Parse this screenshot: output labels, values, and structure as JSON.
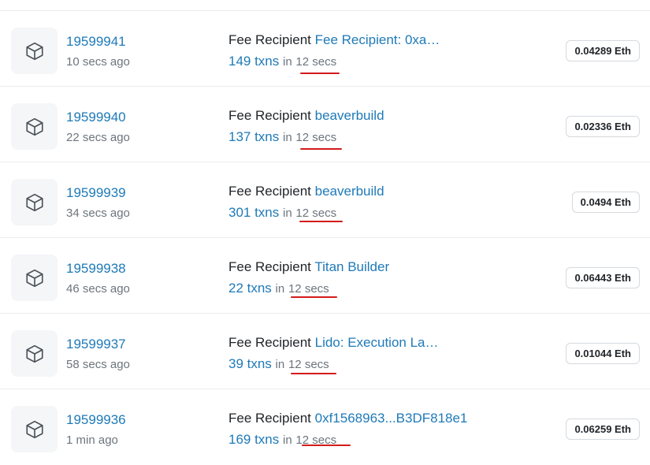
{
  "icons": {
    "block": "cube-icon"
  },
  "colors": {
    "link": "#1e7ab8",
    "muted": "#6c757d",
    "annotation": "#d31b1b"
  },
  "blocks": [
    {
      "number": "19599941",
      "age": "10 secs ago",
      "fee_prefix": "Fee Recipient",
      "fee_recipient": "Fee Recipient: 0xa…",
      "txns": "149 txns",
      "in_word": "in",
      "duration": "12 secs",
      "reward": "0.04289 Eth"
    },
    {
      "number": "19599940",
      "age": "22 secs ago",
      "fee_prefix": "Fee Recipient",
      "fee_recipient": "beaverbuild",
      "txns": "137 txns",
      "in_word": "in",
      "duration": "12 secs",
      "reward": "0.02336 Eth"
    },
    {
      "number": "19599939",
      "age": "34 secs ago",
      "fee_prefix": "Fee Recipient",
      "fee_recipient": "beaverbuild",
      "txns": "301 txns",
      "in_word": "in",
      "duration": "12 secs",
      "reward": "0.0494 Eth"
    },
    {
      "number": "19599938",
      "age": "46 secs ago",
      "fee_prefix": "Fee Recipient",
      "fee_recipient": "Titan Builder",
      "txns": "22 txns",
      "in_word": "in",
      "duration": "12 secs",
      "reward": "0.06443 Eth"
    },
    {
      "number": "19599937",
      "age": "58 secs ago",
      "fee_prefix": "Fee Recipient",
      "fee_recipient": "Lido: Execution La…",
      "txns": "39 txns",
      "in_word": "in",
      "duration": "12 secs",
      "reward": "0.01044 Eth"
    },
    {
      "number": "19599936",
      "age": "1 min ago",
      "fee_prefix": "Fee Recipient",
      "fee_recipient": "0xf1568963...B3DF818e1",
      "txns": "169 txns",
      "in_word": "in",
      "duration": "12 secs",
      "reward": "0.06259 Eth"
    }
  ]
}
